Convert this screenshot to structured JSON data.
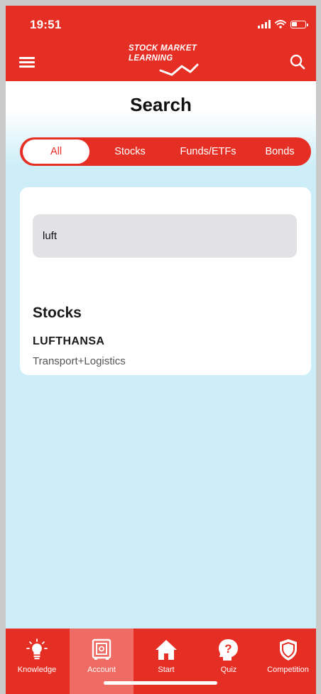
{
  "status_bar": {
    "time": "19:51"
  },
  "header": {
    "logo_line1": "STOCK MARKET",
    "logo_line2": "LEARNING"
  },
  "page": {
    "title": "Search"
  },
  "tabs": [
    {
      "label": "All",
      "active": true
    },
    {
      "label": "Stocks",
      "active": false
    },
    {
      "label": "Funds/ETFs",
      "active": false
    },
    {
      "label": "Bonds",
      "active": false
    }
  ],
  "search": {
    "value": "luft"
  },
  "results": {
    "section_title": "Stocks",
    "items": [
      {
        "name": "LUFTHANSA",
        "sector": "Transport+Logistics"
      }
    ]
  },
  "bottom_nav": [
    {
      "label": "Knowledge",
      "icon": "lightbulb-icon",
      "active": false
    },
    {
      "label": "Account",
      "icon": "safe-icon",
      "active": true
    },
    {
      "label": "Start",
      "icon": "home-icon",
      "active": false
    },
    {
      "label": "Quiz",
      "icon": "question-head-icon",
      "active": false
    },
    {
      "label": "Competition",
      "icon": "shield-icon",
      "active": false
    }
  ],
  "colors": {
    "brand_red": "#e52f25",
    "background": "#cdeef8",
    "active_nav": "#ee6c63"
  }
}
